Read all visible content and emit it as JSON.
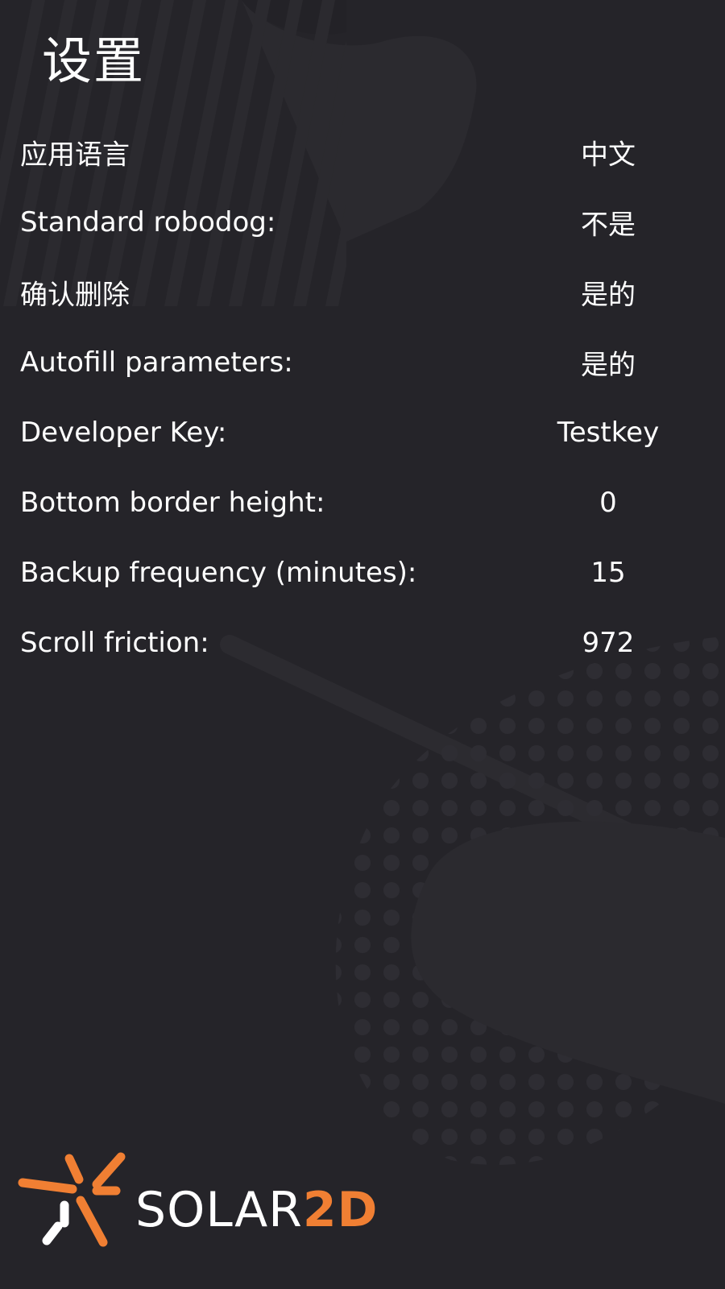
{
  "header": {
    "title": "设置"
  },
  "settings": [
    {
      "label": "应用语言",
      "value": "中文"
    },
    {
      "label": "Standard robodog:",
      "value": "不是"
    },
    {
      "label": "确认删除",
      "value": "是的"
    },
    {
      "label": "Autofill parameters:",
      "value": "是的"
    },
    {
      "label": "Developer Key:",
      "value": "Testkey"
    },
    {
      "label": "Bottom border height:",
      "value": "0"
    },
    {
      "label": "Backup frequency (minutes):",
      "value": "15"
    },
    {
      "label": "Scroll friction:",
      "value": "972"
    }
  ],
  "brand": {
    "name_part1": "SOLAR",
    "name_part2": "2D",
    "accent_color": "#f07f33",
    "text_color": "#ffffff"
  },
  "colors": {
    "background": "#252429",
    "decor": "#2d2c31"
  },
  "icons": {
    "logo": "solar2d-sunburst-icon"
  }
}
